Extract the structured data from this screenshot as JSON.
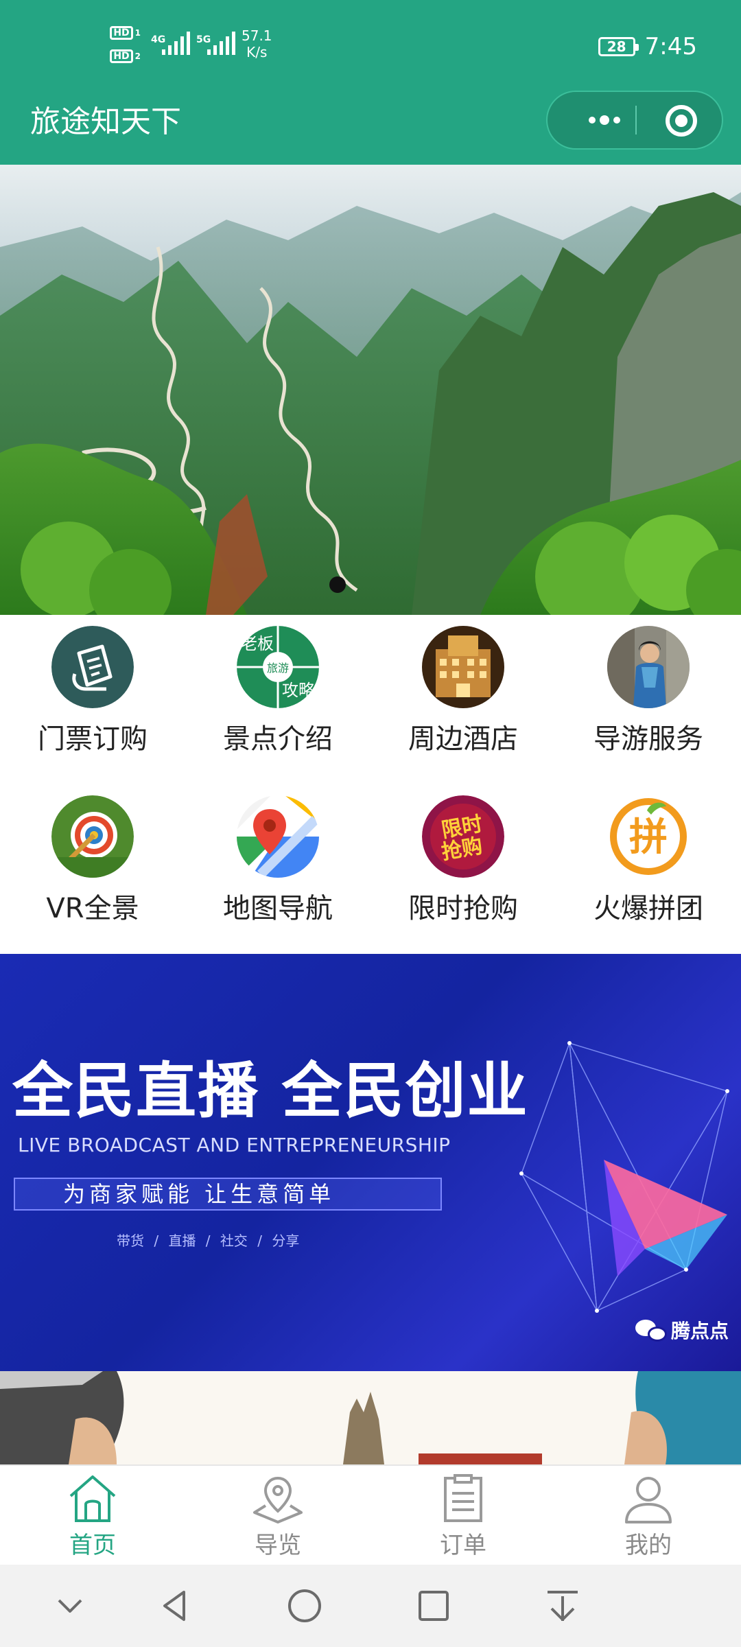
{
  "status_bar": {
    "hd1": "HD",
    "hd1_sub": "1",
    "hd2": "HD",
    "hd2_sub": "2",
    "net1": "4G",
    "net2": "5G",
    "speed_value": "57.1",
    "speed_unit": "K/s",
    "battery": "28",
    "time": "7:45"
  },
  "header": {
    "title": "旅途知天下",
    "more_icon": "more-dots-icon",
    "close_icon": "target-circle-icon",
    "bg_color": "#24a583"
  },
  "banner": {
    "page_count": 1,
    "active_index": 0
  },
  "grid": [
    {
      "label": "门票订购",
      "icon": "ticket-icon"
    },
    {
      "label": "景点介绍",
      "icon": "scenic-spot-icon",
      "icon_text_top": "老板",
      "icon_text_mid": "旅游",
      "icon_text_bot": "攻略"
    },
    {
      "label": "周边酒店",
      "icon": "hotel-icon"
    },
    {
      "label": "导游服务",
      "icon": "tour-guide-icon"
    },
    {
      "label": "VR全景",
      "icon": "vr-target-icon"
    },
    {
      "label": "地图导航",
      "icon": "map-pin-icon"
    },
    {
      "label": "限时抢购",
      "icon": "flash-sale-icon",
      "icon_text_top": "限时",
      "icon_text_bot": "抢购"
    },
    {
      "label": "火爆拼团",
      "icon": "group-buy-icon",
      "icon_text": "拼"
    }
  ],
  "ad": {
    "title": "全民直播 全民创业",
    "subtitle": "LIVE BROADCAST AND ENTREPRENEURSHIP",
    "slogan": "为商家赋能 让生意简单",
    "tags": "带货 / 直播 / 社交 / 分享",
    "brand": "腾点点"
  },
  "tabbar": [
    {
      "label": "首页",
      "icon": "home-icon",
      "active": true
    },
    {
      "label": "导览",
      "icon": "guide-map-pin-icon",
      "active": false
    },
    {
      "label": "订单",
      "icon": "order-document-icon",
      "active": false
    },
    {
      "label": "我的",
      "icon": "user-profile-icon",
      "active": false
    }
  ],
  "colors": {
    "accent": "#24a583",
    "tab_inactive": "#8a8a8a"
  }
}
